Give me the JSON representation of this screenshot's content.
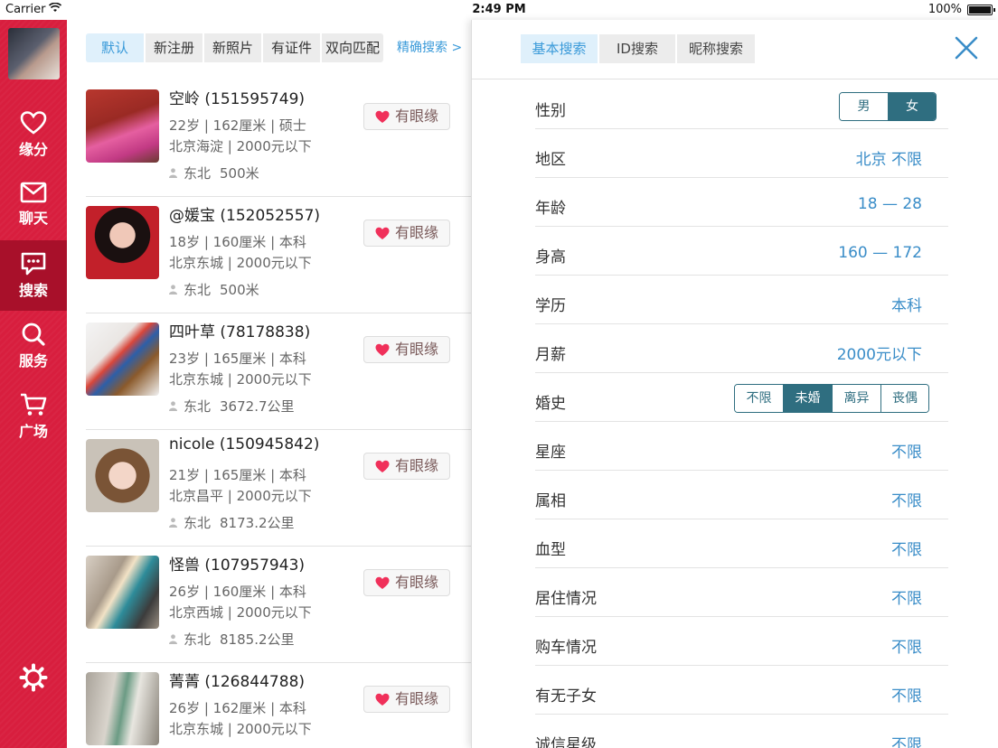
{
  "status_bar": {
    "carrier": "Carrier",
    "time": "2:49 PM",
    "battery": "100%"
  },
  "sidebar": {
    "items": [
      {
        "label": "缘分",
        "icon": "heart-icon"
      },
      {
        "label": "聊天",
        "icon": "mail-icon"
      },
      {
        "label": "搜索",
        "icon": "chat-bubble-icon"
      },
      {
        "label": "服务",
        "icon": "search-icon"
      },
      {
        "label": "广场",
        "icon": "cart-icon"
      }
    ],
    "active_index": 2
  },
  "list": {
    "filters": [
      "默认",
      "新注册",
      "新照片",
      "有证件",
      "双向匹配"
    ],
    "active_filter": 0,
    "precise_search": "精确搜索 >",
    "like_label": "有眼缘",
    "profiles": [
      {
        "name": "空岭 (151595749)",
        "line1": "22岁 | 162厘米 | 硕士",
        "line2": "北京海淀 | 2000元以下",
        "dir": "东北",
        "distance": "500米"
      },
      {
        "name": "@媛宝 (152052557)",
        "line1": "18岁 | 160厘米 | 本科",
        "line2": "北京东城 | 2000元以下",
        "dir": "东北",
        "distance": "500米"
      },
      {
        "name": "四叶草 (78178838)",
        "line1": "23岁 | 165厘米 | 本科",
        "line2": "北京东城 | 2000元以下",
        "dir": "东北",
        "distance": "3672.7公里"
      },
      {
        "name": "nicole (150945842)",
        "line1": "21岁 | 165厘米 | 本科",
        "line2": "北京昌平 | 2000元以下",
        "dir": "东北",
        "distance": "8173.2公里"
      },
      {
        "name": "怪兽 (107957943)",
        "line1": "26岁 | 160厘米 | 本科",
        "line2": "北京西城 | 2000元以下",
        "dir": "东北",
        "distance": "8185.2公里"
      },
      {
        "name": "菁菁 (126844788)",
        "line1": "26岁 | 162厘米 | 本科",
        "line2": "北京东城 | 2000元以下",
        "dir": "东北",
        "distance": ""
      }
    ]
  },
  "panel": {
    "tabs": [
      "基本搜索",
      "ID搜索",
      "昵称搜索"
    ],
    "active_tab": 0,
    "gender": {
      "label": "性别",
      "options": [
        "男",
        "女"
      ],
      "selected": 1
    },
    "region": {
      "label": "地区",
      "value": "北京 不限"
    },
    "age": {
      "label": "年龄",
      "value": "18 — 28"
    },
    "height": {
      "label": "身高",
      "value": "160 — 172"
    },
    "education": {
      "label": "学历",
      "value": "本科"
    },
    "salary": {
      "label": "月薪",
      "value": "2000元以下"
    },
    "marriage": {
      "label": "婚史",
      "options": [
        "不限",
        "未婚",
        "离异",
        "丧偶"
      ],
      "selected": 1
    },
    "zodiac": {
      "label": "星座",
      "value": "不限"
    },
    "chinese_zodiac": {
      "label": "属相",
      "value": "不限"
    },
    "blood": {
      "label": "血型",
      "value": "不限"
    },
    "housing": {
      "label": "居住情况",
      "value": "不限"
    },
    "car": {
      "label": "购车情况",
      "value": "不限"
    },
    "children": {
      "label": "有无子女",
      "value": "不限"
    },
    "credit": {
      "label": "诚信星级",
      "value": "不限"
    }
  },
  "colors": {
    "sidebar": "#d81e3e",
    "accent": "#3a8dc8",
    "segment": "#2f6e80",
    "heart": "#f0305a"
  }
}
